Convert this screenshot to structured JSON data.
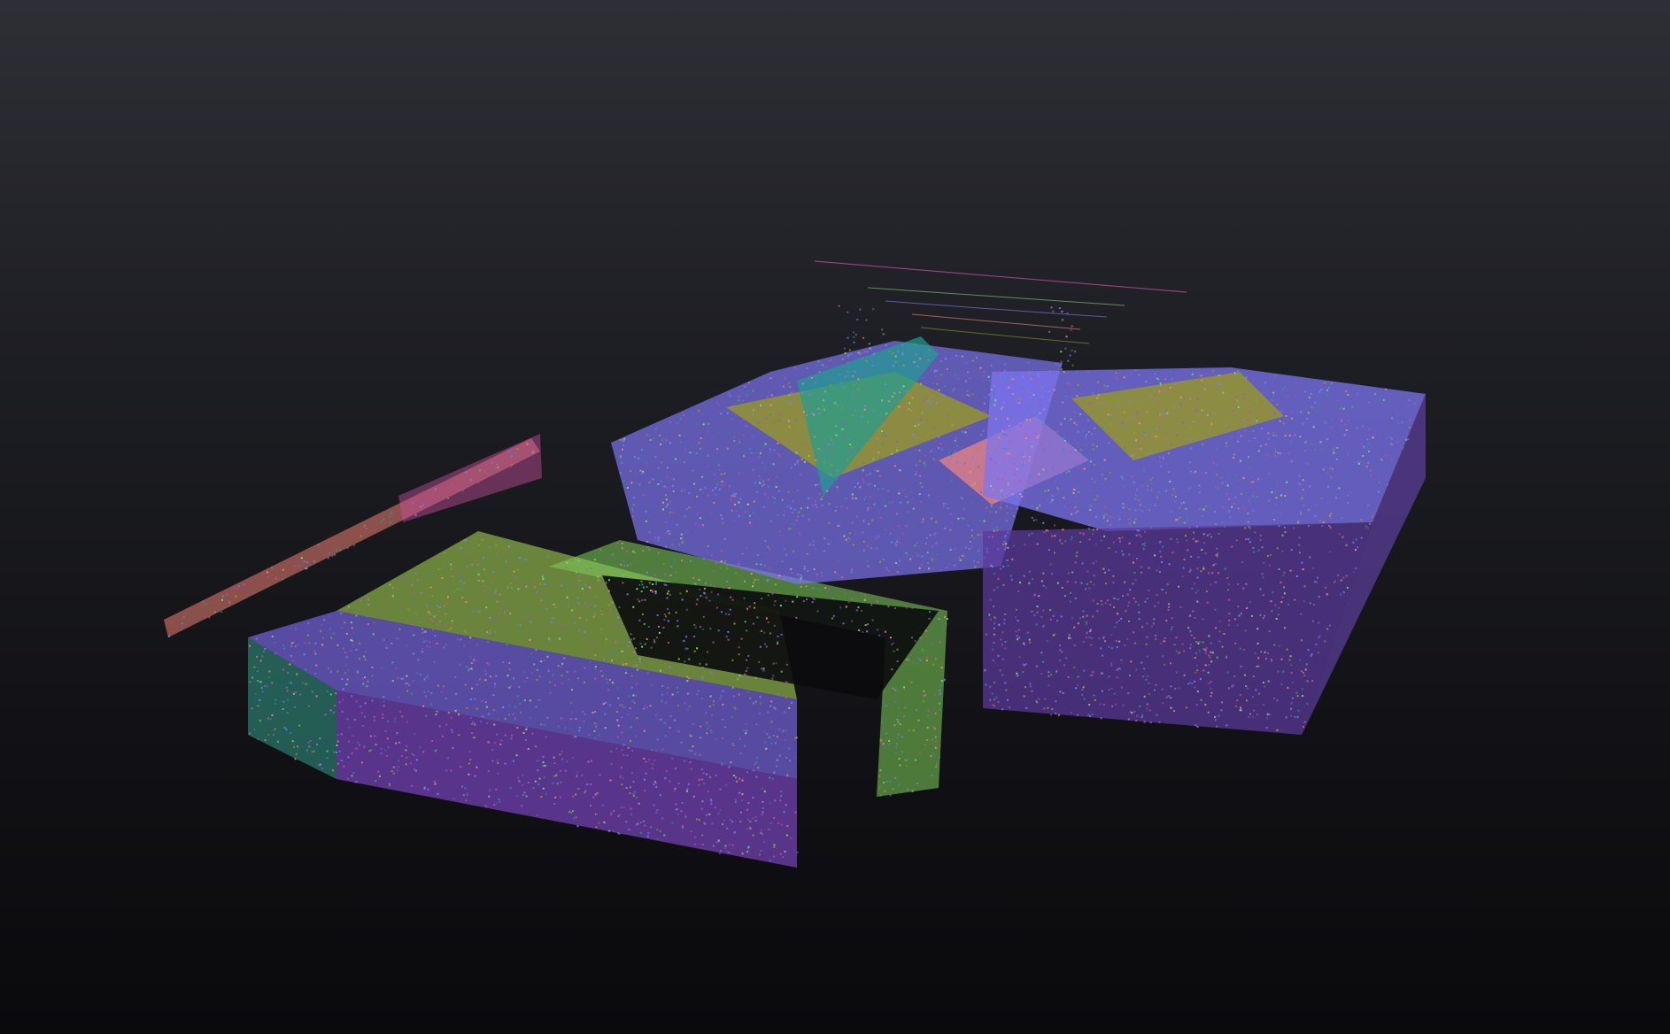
{
  "viewer": {
    "background_top": "#2e2f36",
    "background_bottom": "#0a0a0d"
  },
  "point_cloud": {
    "colormap": "surface-normals",
    "palette": [
      "#8a7cff",
      "#9a9a1a",
      "#7fe07a",
      "#ff8a7a",
      "#1f9e92",
      "#a04fd0",
      "#5a8cff",
      "#c84fa0"
    ]
  }
}
